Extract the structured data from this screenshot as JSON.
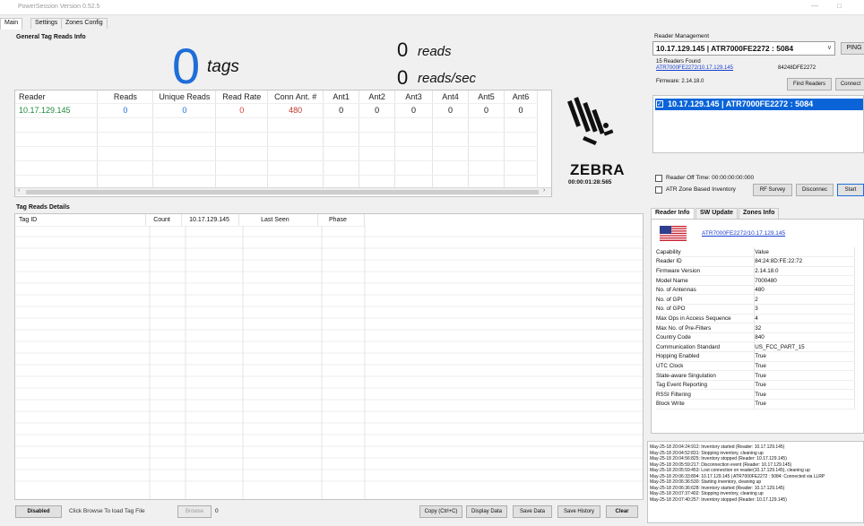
{
  "window": {
    "title": "PowerSession   Version 0.52.5"
  },
  "tabs": [
    "Main",
    "Settings",
    "Zones Config"
  ],
  "general": {
    "group_title": "General Tag Reads Info",
    "tags_count": "0",
    "tags_label": "tags",
    "reads_count": "0",
    "reads_label": "reads",
    "rate_count": "0",
    "rate_label": "reads/sec"
  },
  "reader_table": {
    "headers": [
      "Reader",
      "Reads",
      "Unique Reads",
      "Read Rate",
      "Conn Ant. #",
      "Ant1",
      "Ant2",
      "Ant3",
      "Ant4",
      "Ant5",
      "Ant6"
    ],
    "row": [
      "10.17.129.145",
      "0",
      "0",
      "0",
      "480",
      "0",
      "0",
      "0",
      "0",
      "0",
      "0"
    ]
  },
  "brand": {
    "name": "ZEBRA",
    "timer": "00:00:01:28:565"
  },
  "tag_details": {
    "group_title": "Tag Reads Details",
    "headers": [
      "Tag ID",
      "Count",
      "10.17.129.145",
      "Last Seen",
      "Phase"
    ]
  },
  "bottom_bar": {
    "disabled_label": "Disabled",
    "browse_hint": "Click Browse To load Tag File",
    "browse_label": "Browse",
    "count": "0",
    "copy_label": "Copy (Ctrl+C)",
    "display_label": "Display Data",
    "save_label": "Save Data",
    "history_label": "Save History",
    "clear_label": "Clear"
  },
  "reader_mgmt": {
    "group_title": "Reader Management",
    "selected_reader": "10.17.129.145  |  ATR7000FE2272 : 5084",
    "ping_label": "PING",
    "found_text": "15 Readers Found",
    "reader_link": "ATR7000FE2272/10.17.129.145",
    "reader_id": "84248DFE2272",
    "firmware_text": "Firmware: 2.14.18.0",
    "find_label": "Find Readers",
    "connect_label": "Connect",
    "list_item": "10.17.129.145  |  ATR7000FE2272 : 5084",
    "off_time": "Reader Off Time:  00:00:00:00:000",
    "atr_zone": "ATR Zone Based Inventory",
    "rf_label": "RF Survey",
    "disconnect_label": "Disconnec",
    "start_label": "Start"
  },
  "info_tabs": [
    "Reader Info",
    "SW Update",
    "Zones Info"
  ],
  "reader_info": {
    "link": "ATR7000FE2272/10.17.129.145",
    "col_capability": "Capability",
    "col_value": "Value",
    "rows": [
      [
        "Reader ID",
        "84:24:8D:FE:22:72"
      ],
      [
        "Firmware Version",
        "2.14.18.0"
      ],
      [
        "Model Name",
        "7000480"
      ],
      [
        "No. of Antennas",
        "480"
      ],
      [
        "No. of GPI",
        "2"
      ],
      [
        "No. of GPO",
        "3"
      ],
      [
        "Max Ops in Access Sequence",
        "4"
      ],
      [
        "Max No. of Pre-Filters",
        "32"
      ],
      [
        "Country Code",
        "840"
      ],
      [
        "Communication Standard",
        "US_FCC_PART_15"
      ],
      [
        "Hopping Enabled",
        "True"
      ],
      [
        "UTC Clock",
        "True"
      ],
      [
        "State-aware Singulation",
        "True"
      ],
      [
        "Tag Event Reporting",
        "True"
      ],
      [
        "RSSI Filtering",
        "True"
      ],
      [
        "Block Write",
        "True"
      ]
    ]
  },
  "log": [
    "May-25-18 20:04:24:912: Inventory started (Reader: 10.17.129.145)",
    "May-25-18 20:04:52:831: Stopping inventory, cleaning up",
    "May-25-18 20:04:56:825: Inventory stopped (Reader: 10.17.129.145)",
    "May-25-18 20:05:59:217: Disconnection event (Reader: 10.17.129.145)",
    "May-25-18 20:05:59:453: Lost connection on reader(10.17.129.145), cleaning up",
    "May-25-18 20:06:33:894: 10.17.129.145 | ATR7000FE2272 : 5084: Connected via LLRP",
    "May-25-18 20:06:36:530: Starting inventory, cleaning up",
    "May-25-18 20:06:36:628: Inventory started (Reader: 10.17.129.145)",
    "May-25-18 20:07:37:402: Stopping inventory, cleaning up",
    "May-25-18 20:07:40:257: Inventory stopped (Reader: 10.17.129.145)"
  ],
  "colors": {
    "accent_blue": "#1f6ed8",
    "reader_green": "#1f8a3a",
    "red": "#d93a2a",
    "conn_red": "#c0392b",
    "selection": "#0a64d8"
  }
}
